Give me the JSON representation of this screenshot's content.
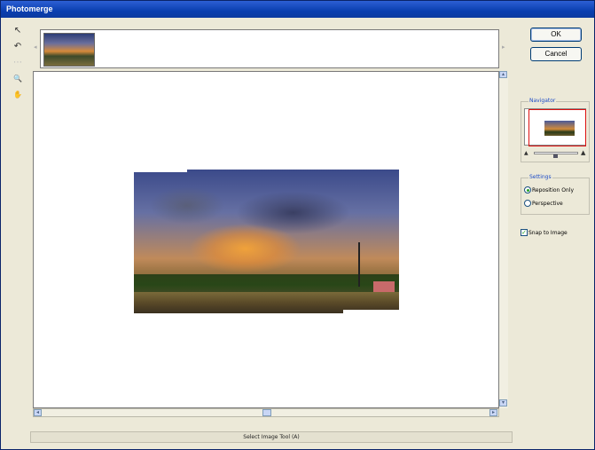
{
  "window": {
    "title": "Photomerge"
  },
  "toolbar": {
    "tools": [
      {
        "icon": "select-image-tool-icon",
        "glyph": "↖"
      },
      {
        "icon": "rotate-image-tool-icon",
        "glyph": "↶"
      },
      {
        "icon": "set-vanishing-point-tool-icon",
        "glyph": "⋯"
      },
      {
        "icon": "zoom-tool-icon",
        "glyph": "🔍"
      },
      {
        "icon": "hand-tool-icon",
        "glyph": "✋"
      }
    ]
  },
  "lightbox": {
    "left_arrow": "◂",
    "right_arrow": "▸"
  },
  "scrollbar": {
    "left": "◂",
    "right": "▸",
    "up": "▴",
    "down": "▾"
  },
  "buttons": {
    "ok": "OK",
    "cancel": "Cancel"
  },
  "navigator": {
    "title": "Navigator",
    "zoom_small_icon": "zoom-out-icon",
    "zoom_large_icon": "zoom-in-icon",
    "zoom_small_glyph": "▲",
    "zoom_large_glyph": "▲"
  },
  "settings": {
    "title": "Settings",
    "options": [
      {
        "label": "Reposition Only",
        "checked": true
      },
      {
        "label": "Perspective",
        "checked": false
      }
    ]
  },
  "snap_to_image": {
    "label": "Snap to Image",
    "checked": true
  },
  "status": {
    "text": "Select Image Tool (A)"
  }
}
